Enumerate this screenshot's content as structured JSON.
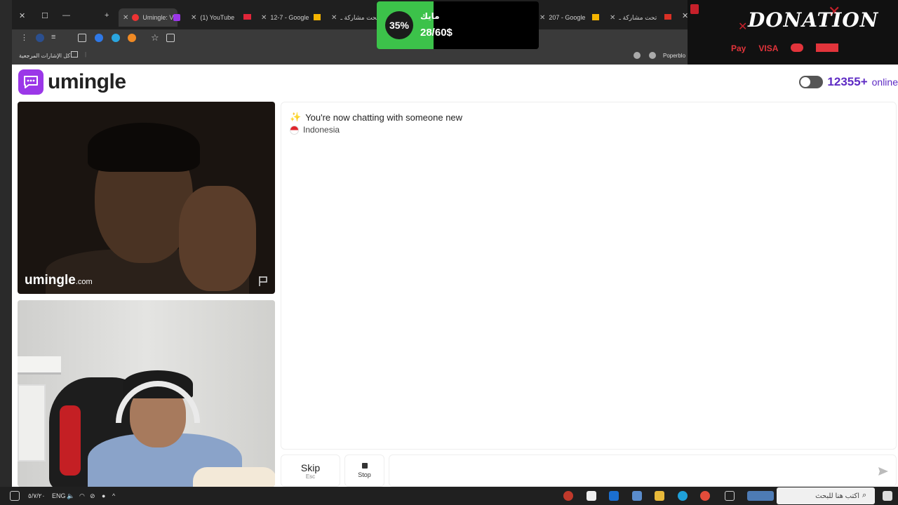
{
  "browser": {
    "tabs": [
      {
        "label": "Umingle: V",
        "active": true
      },
      {
        "label": "(1) YouTube"
      },
      {
        "label": "12-7 - Google"
      },
      {
        "label": "تحت مشاركة ـ"
      },
      {
        "label": "207 - Google"
      },
      {
        "label": "تحت مشاركة ـ"
      }
    ],
    "bookmarks_label": "كل الإشارات المرجعية",
    "bookmark_right": "Poperblo"
  },
  "overlays": {
    "goal": {
      "percent_text": "35%",
      "percent": 35,
      "label": "مايك",
      "amount": "28/60$"
    },
    "donation": {
      "title": "DONATION",
      "methods": [
        "Pay",
        "VISA"
      ]
    }
  },
  "site": {
    "logo_text": "umingle",
    "online_count": "12355+",
    "online_word": "online"
  },
  "video": {
    "watermark_main": "umingle",
    "watermark_suffix": ".com"
  },
  "chat": {
    "system_message": "You're now chatting with someone new",
    "country": "Indonesia"
  },
  "controls": {
    "skip_label": "Skip",
    "skip_hint": "Esc",
    "stop_label": "Stop",
    "input_placeholder": ""
  },
  "taskbar": {
    "lang": "ENG",
    "date": "٥/٧/٢٠",
    "search_placeholder": "اكتب هنا للبحث"
  },
  "colors": {
    "brand": "#9b37e8",
    "online_accent": "#5e2bc4",
    "goal_green": "#3cc24a",
    "donation_red": "#c6202a"
  }
}
